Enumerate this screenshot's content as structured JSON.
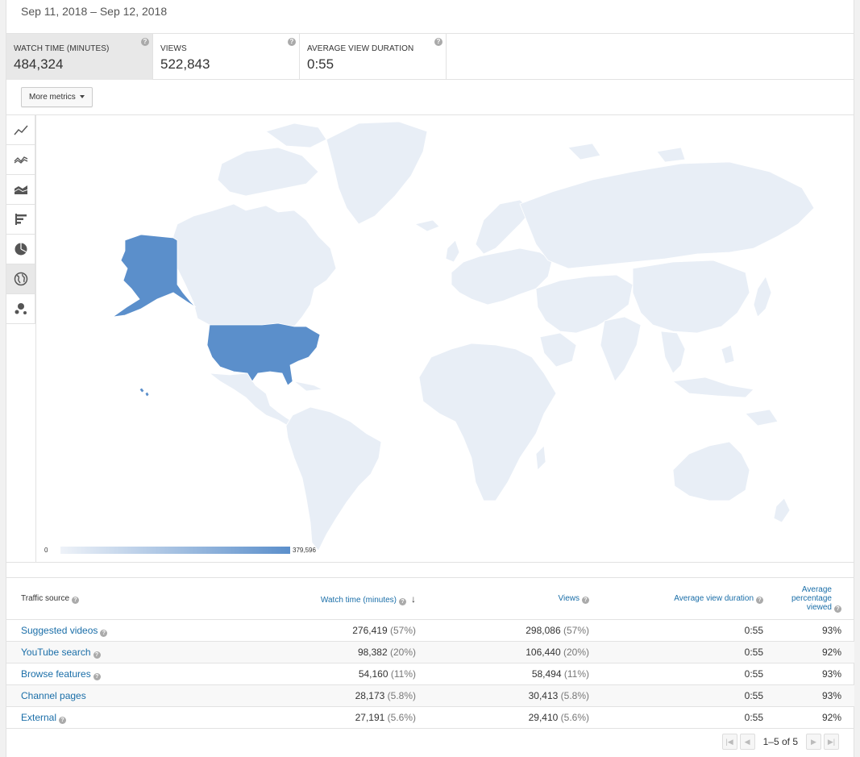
{
  "date_range": "Sep 11, 2018 – Sep 12, 2018",
  "metrics": [
    {
      "label": "WATCH TIME (MINUTES)",
      "value": "484,324",
      "active": true
    },
    {
      "label": "VIEWS",
      "value": "522,843",
      "active": false
    },
    {
      "label": "AVERAGE VIEW DURATION",
      "value": "0:55",
      "active": false
    }
  ],
  "more_metrics_label": "More metrics",
  "chart_tools": [
    {
      "name": "line-chart-icon",
      "active": false
    },
    {
      "name": "multiline-chart-icon",
      "active": false
    },
    {
      "name": "stacked-area-chart-icon",
      "active": false
    },
    {
      "name": "bar-chart-icon",
      "active": false
    },
    {
      "name": "pie-chart-icon",
      "active": false
    },
    {
      "name": "globe-map-icon",
      "active": true
    },
    {
      "name": "bubble-chart-icon",
      "active": false
    }
  ],
  "map": {
    "highlight_color": "#5b8fcb",
    "base_color": "#e8eef6",
    "legend_min": "0",
    "legend_max": "379,596",
    "highlighted_regions": [
      "United States",
      "Alaska",
      "Hawaii"
    ]
  },
  "table": {
    "headers": {
      "traffic_source": "Traffic source",
      "watch_time": "Watch time (minutes)",
      "views": "Views",
      "avg_view_duration": "Average view duration",
      "avg_pct_viewed": "Average percentage viewed"
    },
    "rows": [
      {
        "source": "Suggested videos",
        "watch": "276,419",
        "watch_pct": "(57%)",
        "views": "298,086",
        "views_pct": "(57%)",
        "duration": "0:55",
        "pct_viewed": "93%",
        "has_help": true
      },
      {
        "source": "YouTube search",
        "watch": "98,382",
        "watch_pct": "(20%)",
        "views": "106,440",
        "views_pct": "(20%)",
        "duration": "0:55",
        "pct_viewed": "92%",
        "has_help": true
      },
      {
        "source": "Browse features",
        "watch": "54,160",
        "watch_pct": "(11%)",
        "views": "58,494",
        "views_pct": "(11%)",
        "duration": "0:55",
        "pct_viewed": "93%",
        "has_help": true
      },
      {
        "source": "Channel pages",
        "watch": "28,173",
        "watch_pct": "(5.8%)",
        "views": "30,413",
        "views_pct": "(5.8%)",
        "duration": "0:55",
        "pct_viewed": "93%",
        "has_help": false
      },
      {
        "source": "External",
        "watch": "27,191",
        "watch_pct": "(5.6%)",
        "views": "29,410",
        "views_pct": "(5.6%)",
        "duration": "0:55",
        "pct_viewed": "92%",
        "has_help": true
      }
    ]
  },
  "pager": {
    "range": "1–5 of",
    "total": "5"
  }
}
